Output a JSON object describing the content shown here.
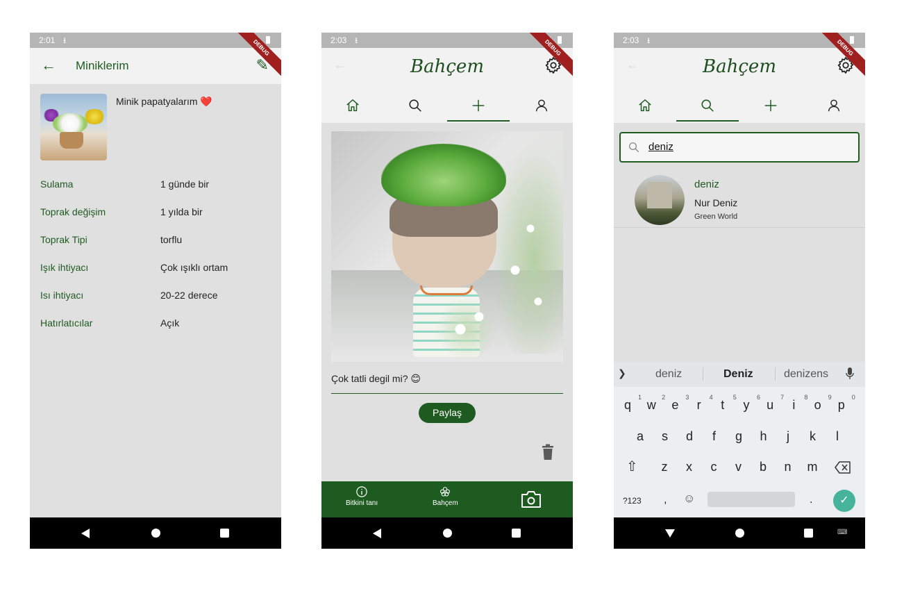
{
  "phone1": {
    "status": {
      "time": "2:01"
    },
    "debug_label": "DEBUG",
    "appbar": {
      "title": "Miniklerim"
    },
    "caption": "Minik papatyalarım ❤️",
    "details": [
      {
        "key": "Sulama",
        "value": "1 günde bir"
      },
      {
        "key": "Toprak değişim",
        "value": "1 yılda bir"
      },
      {
        "key": "Toprak Tipi",
        "value": "torflu"
      },
      {
        "key": "Işık ihtiyacı",
        "value": "Çok ışıklı ortam"
      },
      {
        "key": "Isı ihtiyacı",
        "value": "20-22 derece"
      },
      {
        "key": "Hatırlatıcılar",
        "value": "Açık"
      }
    ]
  },
  "phone2": {
    "status": {
      "time": "2:03"
    },
    "debug_label": "DEBUG",
    "brand": "Bahçem",
    "tabs": [
      {
        "icon": "home-icon",
        "active": false
      },
      {
        "icon": "search-icon",
        "active": false
      },
      {
        "icon": "plus-icon",
        "active": true
      },
      {
        "icon": "person-icon",
        "active": false
      }
    ],
    "caption_value": "Çok tatli degil mi? 😊",
    "share_label": "Paylaş",
    "bottom_nav": {
      "identify_label": "Bitkini tanı",
      "garden_label": "Bahçem"
    }
  },
  "phone3": {
    "status": {
      "time": "2:03"
    },
    "debug_label": "DEBUG",
    "brand": "Bahçem",
    "tabs": [
      {
        "icon": "home-icon",
        "active": false
      },
      {
        "icon": "search-icon",
        "active": true
      },
      {
        "icon": "plus-icon",
        "active": false
      },
      {
        "icon": "person-icon",
        "active": false
      }
    ],
    "search_value": "deniz",
    "result": {
      "username": "deniz",
      "fullname": "Nur Deniz",
      "subtitle": "Green World"
    },
    "keyboard": {
      "suggestions": [
        "deniz",
        "Deniz",
        "denizens"
      ],
      "row1": [
        {
          "k": "q",
          "n": "1"
        },
        {
          "k": "w",
          "n": "2"
        },
        {
          "k": "e",
          "n": "3"
        },
        {
          "k": "r",
          "n": "4"
        },
        {
          "k": "t",
          "n": "5"
        },
        {
          "k": "y",
          "n": "6"
        },
        {
          "k": "u",
          "n": "7"
        },
        {
          "k": "i",
          "n": "8"
        },
        {
          "k": "o",
          "n": "9"
        },
        {
          "k": "p",
          "n": "0"
        }
      ],
      "row2": [
        "a",
        "s",
        "d",
        "f",
        "g",
        "h",
        "j",
        "k",
        "l"
      ],
      "row3": [
        "z",
        "x",
        "c",
        "v",
        "b",
        "n",
        "m"
      ],
      "symbols_label": "?123",
      "comma": ",",
      "period": "."
    }
  },
  "colors": {
    "brand_green": "#1e5b20",
    "background": "#e0e0e0",
    "header_bg": "#f2f2f2",
    "enter_key": "#46b39a"
  }
}
